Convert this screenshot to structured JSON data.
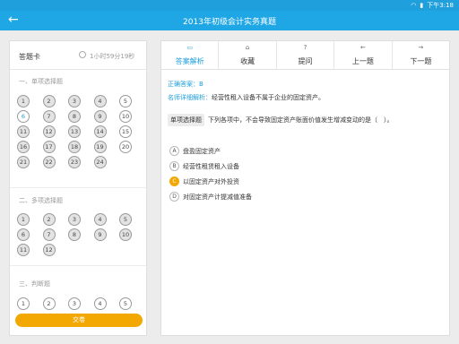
{
  "status": {
    "time": "下午3:18"
  },
  "appbar": {
    "title": "2013年初级会计实务真题"
  },
  "card": {
    "title": "答题卡",
    "time": "1小时59分19秒",
    "sections": [
      {
        "label": "一、单项选择题",
        "nums": [
          "1",
          "2",
          "3",
          "4",
          "5",
          "6",
          "7",
          "8",
          "9",
          "10",
          "11",
          "12",
          "13",
          "14",
          "15",
          "16",
          "17",
          "18",
          "19",
          "20",
          "21",
          "22",
          "23",
          "24"
        ]
      },
      {
        "label": "二、多项选择题",
        "nums": [
          "1",
          "2",
          "3",
          "4",
          "5",
          "6",
          "7",
          "8",
          "9",
          "10",
          "11",
          "12"
        ]
      },
      {
        "label": "三、判断题",
        "nums": [
          "1",
          "2",
          "3",
          "4",
          "5"
        ]
      }
    ],
    "submit": "交卷"
  },
  "tabs": [
    {
      "icon": "▭",
      "label": "答案解析"
    },
    {
      "icon": "⌂",
      "label": "收藏"
    },
    {
      "icon": "?",
      "label": "提问"
    },
    {
      "icon": "←",
      "label": "上一题"
    },
    {
      "icon": "→",
      "label": "下一题"
    }
  ],
  "answer": "正确答案：B",
  "explanation": {
    "key": "名师详细解析：",
    "text": "经营性租入设备不属于企业的固定资产。"
  },
  "question": {
    "type": "单项选择题",
    "text": "下列各项中，不会导致固定资产账面价值发生增减变动的是（　）。"
  },
  "options": [
    {
      "letter": "A",
      "text": "盘盈固定资产"
    },
    {
      "letter": "B",
      "text": "经营性租赁租入设备"
    },
    {
      "letter": "C",
      "text": "以固定资产对外投资"
    },
    {
      "letter": "D",
      "text": "对固定资产计提减值准备"
    }
  ]
}
